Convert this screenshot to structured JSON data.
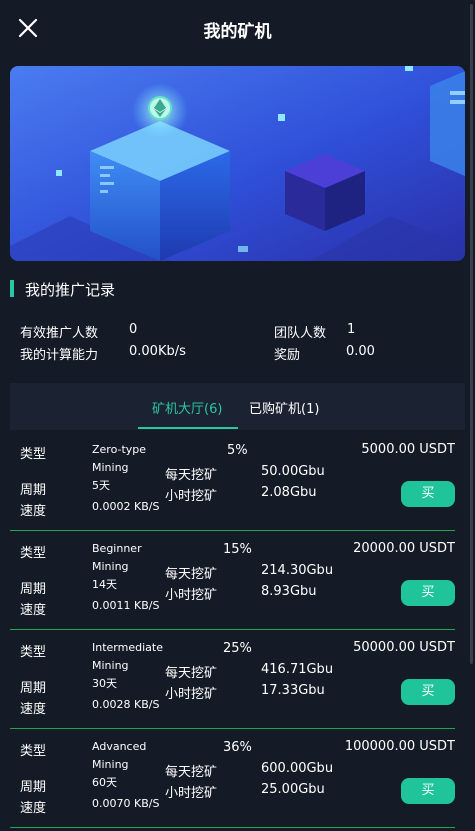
{
  "header": {
    "title": "我的矿机"
  },
  "section": {
    "title": "我的推广记录"
  },
  "stats": {
    "effective_label": "有效推广人数",
    "effective_value": "0",
    "team_label": "团队人数",
    "team_value": "1",
    "power_label": "我的计算能力",
    "power_value": "0.00Kb/s",
    "reward_label": "奖励",
    "reward_value": "0.00"
  },
  "tabs": [
    {
      "label": "矿机大厅(6)",
      "active": true
    },
    {
      "label": "已购矿机(1)",
      "active": false
    }
  ],
  "labels": {
    "type": "类型",
    "period": "周期",
    "speed": "速度",
    "daily": "每天挖矿",
    "hourly": "小时挖矿",
    "buy": "买"
  },
  "machines": [
    {
      "name_line1": "Zero-type",
      "name_line2": "Mining",
      "days": "5天",
      "speed": "0.0002 KB/S",
      "rate": "5%",
      "daily": "50.00Gbu",
      "hourly": "2.08Gbu",
      "price": "5000.00 USDT"
    },
    {
      "name_line1": "Beginner",
      "name_line2": "Mining",
      "days": "14天",
      "speed": "0.0011 KB/S",
      "rate": "15%",
      "daily": "214.30Gbu",
      "hourly": "8.93Gbu",
      "price": "20000.00 USDT"
    },
    {
      "name_line1": "Intermediate",
      "name_line2": "Mining",
      "days": "30天",
      "speed": "0.0028 KB/S",
      "rate": "25%",
      "daily": "416.71Gbu",
      "hourly": "17.33Gbu",
      "price": "50000.00 USDT"
    },
    {
      "name_line1": "Advanced",
      "name_line2": "Mining",
      "days": "60天",
      "speed": "0.0070 KB/S",
      "rate": "36%",
      "daily": "600.00Gbu",
      "hourly": "25.00Gbu",
      "price": "100000.00 USDT"
    }
  ],
  "colors": {
    "accent": "#29c7a4",
    "buy_button": "#1fc49a",
    "divider": "#1ea64f",
    "background": "#141a26"
  }
}
